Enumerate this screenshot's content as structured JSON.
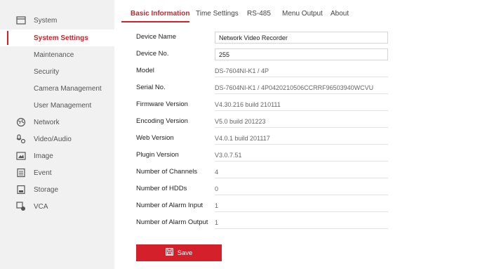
{
  "sidebar": {
    "items": [
      {
        "label": "System",
        "icon": "system-icon"
      },
      {
        "label": "System Settings"
      },
      {
        "label": "Maintenance"
      },
      {
        "label": "Security"
      },
      {
        "label": "Camera Management"
      },
      {
        "label": "User Management"
      },
      {
        "label": "Network",
        "icon": "network-icon"
      },
      {
        "label": "Video/Audio",
        "icon": "video-audio-icon"
      },
      {
        "label": "Image",
        "icon": "image-icon"
      },
      {
        "label": "Event",
        "icon": "event-icon"
      },
      {
        "label": "Storage",
        "icon": "storage-icon"
      },
      {
        "label": "VCA",
        "icon": "vca-icon"
      }
    ],
    "active": "System Settings"
  },
  "tabs": [
    {
      "label": "Basic Information",
      "active": true
    },
    {
      "label": "Time Settings"
    },
    {
      "label": "RS-485"
    },
    {
      "label": "Menu Output"
    },
    {
      "label": "About"
    }
  ],
  "form": {
    "rows": [
      {
        "label": "Device Name",
        "value": "Network Video Recorder",
        "editable": true
      },
      {
        "label": "Device No.",
        "value": "255",
        "editable": true
      },
      {
        "label": "Model",
        "value": "DS-7604NI-K1 / 4P"
      },
      {
        "label": "Serial No.",
        "value": "DS-7604NI-K1 / 4P0420210506CCRRF96503940WCVU"
      },
      {
        "label": "Firmware Version",
        "value": "V4.30.216 build 210111"
      },
      {
        "label": "Encoding Version",
        "value": "V5.0 build 201223"
      },
      {
        "label": "Web Version",
        "value": "V4.0.1 build 201117"
      },
      {
        "label": "Plugin Version",
        "value": "V3.0.7.51"
      },
      {
        "label": "Number of Channels",
        "value": "4"
      },
      {
        "label": "Number of HDDs",
        "value": "0"
      },
      {
        "label": "Number of Alarm Input",
        "value": "1"
      },
      {
        "label": "Number of Alarm Output",
        "value": "1"
      }
    ]
  },
  "save": {
    "label": "Save",
    "icon": "save-icon"
  },
  "colors": {
    "accent": "#d3202a",
    "sidebar_bg": "#f1f1f1"
  }
}
